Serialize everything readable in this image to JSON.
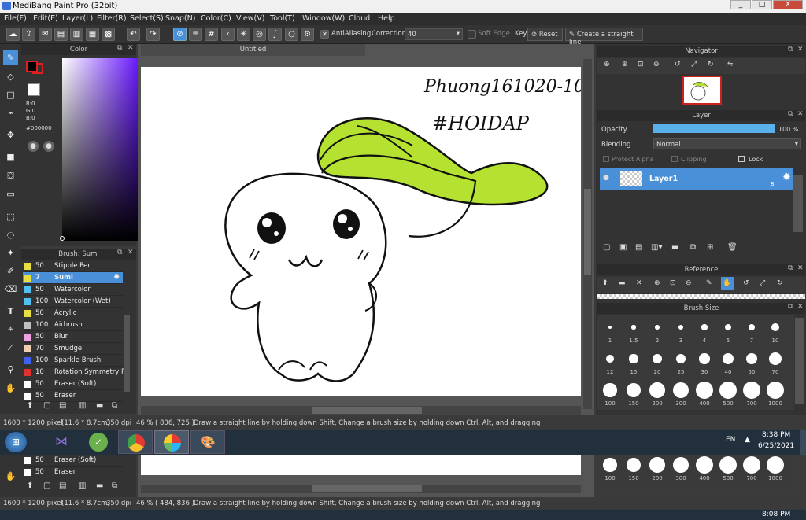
{
  "window": {
    "title": "MediBang Paint Pro (32bit)",
    "minimize": "_",
    "restore": "□",
    "close": "X"
  },
  "menu": [
    "File(F)",
    "Edit(E)",
    "Layer(L)",
    "Filter(R)",
    "Select(S)",
    "Snap(N)",
    "Color(C)",
    "View(V)",
    "Tool(T)",
    "Window(W)",
    "Cloud",
    "Help"
  ],
  "toolbar": {
    "antialiasing_label": "AntiAliasing",
    "correction_label": "Correction",
    "correction_value": "40",
    "soft_edge_label": "Soft Edge",
    "key_label": "Key",
    "reset_label": "Reset",
    "straight_line_label": "Create a straight line"
  },
  "color_panel": {
    "title": "Color",
    "r": "R:0",
    "g": "G:0",
    "b": "B:0",
    "hex": "#000000",
    "fg_color": "#000000",
    "bg_color": "#ffffff"
  },
  "brush_panel": {
    "title": "Brush: Sumi",
    "items": [
      {
        "size": "50",
        "label": "Stipple Pen",
        "color": "#e8e040"
      },
      {
        "size": "7",
        "label": "Sumi",
        "color": "#e8e040",
        "selected": true
      },
      {
        "size": "50",
        "label": "Watercolor",
        "color": "#50c0f0"
      },
      {
        "size": "100",
        "label": "Watercolor (Wet)",
        "color": "#50c0f0"
      },
      {
        "size": "50",
        "label": "Acrylic",
        "color": "#e8e040"
      },
      {
        "size": "100",
        "label": "Airbrush",
        "color": "#c0c0c0"
      },
      {
        "size": "50",
        "label": "Blur",
        "color": "#f0a0e0"
      },
      {
        "size": "70",
        "label": "Smudge",
        "color": "#f0d0b0"
      },
      {
        "size": "100",
        "label": "Sparkle Brush",
        "color": "#4060f0"
      },
      {
        "size": "10",
        "label": "Rotation Symmetry P",
        "color": "#e03030"
      },
      {
        "size": "50",
        "label": "Eraser (Soft)",
        "color": "#ffffff"
      },
      {
        "size": "50",
        "label": "Eraser",
        "color": "#ffffff"
      }
    ]
  },
  "canvas": {
    "tab_title": "Untitled",
    "handwriting_line1": "Phuong161020-10",
    "handwriting_line2": "#HOIDAP"
  },
  "navigator": {
    "title": "Navigator"
  },
  "layer_panel": {
    "title": "Layer",
    "opacity_label": "Opacity",
    "opacity_value": "100 %",
    "opacity_fraction": 1.0,
    "blending_label": "Blending",
    "blending_value": "Normal",
    "protect_alpha": "Protect Alpha",
    "clipping": "Clipping",
    "lock": "Lock",
    "layer_name": "Layer1",
    "layer_badge": "8"
  },
  "reference": {
    "title": "Reference"
  },
  "brush_size": {
    "title": "Brush Size",
    "sizes": [
      "1",
      "1.5",
      "2",
      "3",
      "4",
      "5",
      "7",
      "10",
      "12",
      "15",
      "20",
      "25",
      "30",
      "40",
      "50",
      "70",
      "100",
      "150",
      "200",
      "300",
      "400",
      "500",
      "700",
      "1000"
    ]
  },
  "status": {
    "dimensions": "1600 * 1200 pixel",
    "physical": "(11.6 * 8.7cm)",
    "dpi": "350 dpi",
    "zoom": "46 %",
    "coords": "( 806, 725 )",
    "hint": "Draw a straight line by holding down Shift, Change a brush size by holding down Ctrl, Alt, and dragging"
  },
  "ghost_status": {
    "dimensions": "1600 * 1200 pixel",
    "physical": "(11.6 * 8.7cm)",
    "dpi": "350 dpi",
    "zoom": "46 %",
    "coords": "( 484, 836 )",
    "hint": "Draw a straight line by holding down Shift, Change a brush size by holding down Ctrl, Alt, and dragging",
    "time": "8:08 PM"
  },
  "taskbar": {
    "lang": "EN",
    "time": "8:38 PM",
    "date": "6/25/2021"
  }
}
